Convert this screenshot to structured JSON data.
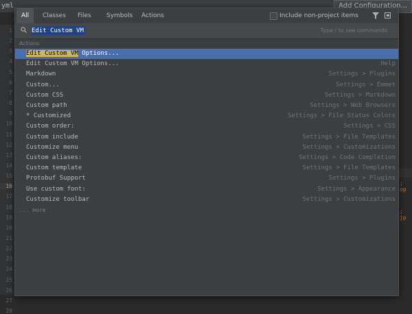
{
  "background": {
    "file_tab": "yml",
    "add_config_button": "Add Configuration...",
    "line_numbers": [
      "1",
      "2",
      "3",
      "4",
      "5",
      "6",
      "7",
      "8",
      "9",
      "10",
      "11",
      "12",
      "13",
      "14",
      "15",
      "16",
      "17",
      "18",
      "19",
      "20",
      "21",
      "22",
      "23",
      "24",
      "25",
      "26",
      "27",
      "28"
    ],
    "current_line": "16",
    "fragments": {
      "line17_right": "; op",
      "line20_right": "; jp"
    }
  },
  "popup": {
    "tabs": [
      "All",
      "Classes",
      "Files",
      "Symbols",
      "Actions"
    ],
    "active_tab": "All",
    "include_non_project_label": "Include non-project items",
    "search": {
      "value": "Edit Custom VM",
      "hint": "Type / to see commands"
    },
    "group_label": "Actions",
    "results": [
      {
        "highlight": "Edit Custom VM",
        "rest": " Options...",
        "location": "",
        "selected": true
      },
      {
        "highlight": "",
        "rest": "Edit Custom VM Options...",
        "location": "Help"
      },
      {
        "highlight": "",
        "rest": "Markdown",
        "location": "Settings > Plugins"
      },
      {
        "highlight": "",
        "rest": "Custom...",
        "location": "Settings > Emmet"
      },
      {
        "highlight": "",
        "rest": "Custom CSS",
        "location": "Settings > Markdown"
      },
      {
        "highlight": "",
        "rest": "Custom path",
        "location": "Settings > Web Browsers"
      },
      {
        "highlight": "",
        "rest": "* Customized",
        "location": "Settings > File Status Colors"
      },
      {
        "highlight": "",
        "rest": "Custom order:",
        "location": "Settings > CSS"
      },
      {
        "highlight": "",
        "rest": "Custom include",
        "location": "Settings > File Templates"
      },
      {
        "highlight": "",
        "rest": "Customize menu",
        "location": "Settings > Customizations"
      },
      {
        "highlight": "",
        "rest": "Custom aliases:",
        "location": "Settings > Code Completion"
      },
      {
        "highlight": "",
        "rest": "Custom template",
        "location": "Settings > File Templates"
      },
      {
        "highlight": "",
        "rest": "Protobuf Support",
        "location": "Settings > Plugins"
      },
      {
        "highlight": "",
        "rest": "Use custom font:",
        "location": "Settings > Appearance"
      },
      {
        "highlight": "",
        "rest": "Customize toolbar",
        "location": "Settings > Customizations"
      }
    ],
    "more_label": "... more"
  },
  "colors": {
    "selection": "#4b6eaf",
    "match_highlight": "#cdb65f",
    "popup_bg": "#3c3f41",
    "editor_bg": "#2b2b2b"
  },
  "icons": {
    "filter": "filter-icon",
    "pin": "pin-window-icon",
    "search": "search-icon"
  }
}
